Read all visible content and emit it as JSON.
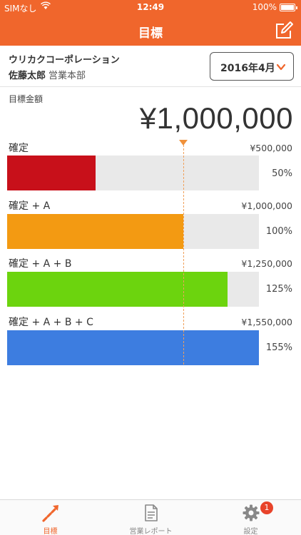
{
  "status_bar": {
    "carrier": "SIMなし",
    "time": "12:49",
    "battery": "100%"
  },
  "header": {
    "title": "目標",
    "edit_icon": "edit-icon"
  },
  "account": {
    "company": "ウリカクコーポレーション",
    "person_name": "佐藤太郎",
    "department": "営業本部"
  },
  "date_select": {
    "value": "2016年4月"
  },
  "target": {
    "label": "目標金額",
    "amount": "¥1,000,000"
  },
  "rows": [
    {
      "label": "確定",
      "amount": "¥500,000",
      "percent_text": "50%",
      "ratio": 0.5,
      "color": "#c8101a"
    },
    {
      "label": "確定 + A",
      "amount": "¥1,000,000",
      "percent_text": "100%",
      "ratio": 1.0,
      "color": "#f39a12"
    },
    {
      "label": "確定 + A + B",
      "amount": "¥1,250,000",
      "percent_text": "125%",
      "ratio": 1.25,
      "color": "#6cd40e"
    },
    {
      "label": "確定 + A + B + C",
      "amount": "¥1,550,000",
      "percent_text": "155%",
      "ratio": 1.55,
      "color": "#3d7de0"
    }
  ],
  "tabs": [
    {
      "label": "目標",
      "icon": "goal-icon",
      "active": true
    },
    {
      "label": "営業レポート",
      "icon": "report-icon",
      "active": false
    },
    {
      "label": "設定",
      "icon": "gear-icon",
      "active": false,
      "badge": "1"
    }
  ],
  "colors": {
    "accent": "#f0662c",
    "marker": "#f0913a"
  }
}
